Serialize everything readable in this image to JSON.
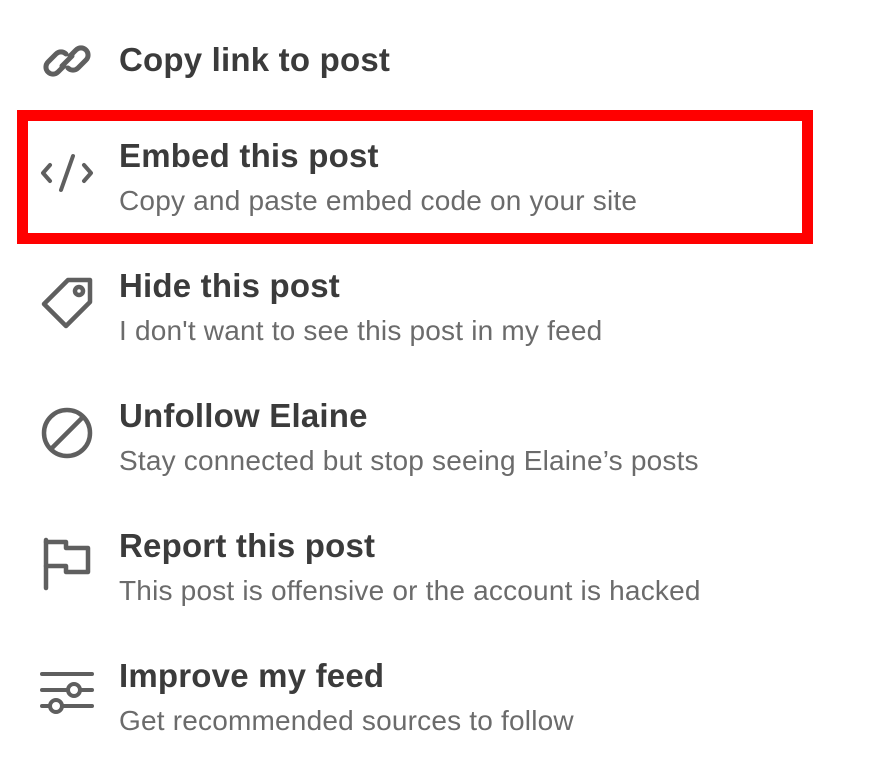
{
  "menu": {
    "items": [
      {
        "icon": "link-icon",
        "title": "Copy link to post",
        "subtitle": ""
      },
      {
        "icon": "code-icon",
        "title": "Embed this post",
        "subtitle": "Copy and paste embed code on your site"
      },
      {
        "icon": "tag-icon",
        "title": "Hide this post",
        "subtitle": "I don't want to see this post in my feed"
      },
      {
        "icon": "block-icon",
        "title": "Unfollow Elaine",
        "subtitle": "Stay connected but stop seeing Elaine’s posts"
      },
      {
        "icon": "flag-icon",
        "title": "Report this post",
        "subtitle": "This post is offensive or the account is hacked"
      },
      {
        "icon": "sliders-icon",
        "title": "Improve my feed",
        "subtitle": "Get recommended sources to follow"
      }
    ],
    "highlight_color": "#ff0000",
    "title_color": "#3b3b3b",
    "subtitle_color": "#6b6b6b",
    "icon_color": "#5f5f5f"
  }
}
